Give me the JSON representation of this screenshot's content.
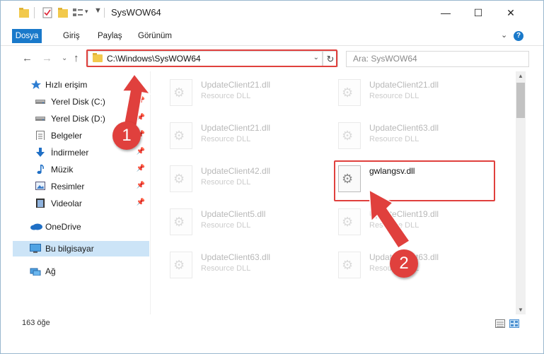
{
  "window": {
    "title": "SysWOW64",
    "minimize": "—",
    "maximize": "☐",
    "close": "✕"
  },
  "ribbon": {
    "tabs": [
      "Dosya",
      "Giriş",
      "Paylaş",
      "Görünüm"
    ],
    "expand": "⌄",
    "help": "?"
  },
  "address": {
    "path": "C:\\Windows\\SysWOW64",
    "dropdown": "⌄",
    "refresh": "↻",
    "search_placeholder": "Ara: SysWOW64"
  },
  "nav": {
    "back": "←",
    "forward": "→",
    "recent": "⌄",
    "up": "↑"
  },
  "sidebar": {
    "items": [
      {
        "label": "Hızlı erişim",
        "icon": "star-icon",
        "pinned": false
      },
      {
        "label": "Yerel Disk (C:)",
        "icon": "drive-icon",
        "pinned": true
      },
      {
        "label": "Yerel Disk (D:)",
        "icon": "drive-icon",
        "pinned": true
      },
      {
        "label": "Belgeler",
        "icon": "documents-icon",
        "pinned": true
      },
      {
        "label": "İndirmeler",
        "icon": "download-icon",
        "pinned": true
      },
      {
        "label": "Müzik",
        "icon": "music-icon",
        "pinned": true
      },
      {
        "label": "Resimler",
        "icon": "pictures-icon",
        "pinned": true
      },
      {
        "label": "Videolar",
        "icon": "videos-icon",
        "pinned": true
      },
      {
        "label": "OneDrive",
        "icon": "cloud-icon",
        "pinned": false
      },
      {
        "label": "Bu bilgisayar",
        "icon": "computer-icon",
        "pinned": false
      },
      {
        "label": "Ağ",
        "icon": "network-icon",
        "pinned": false
      }
    ],
    "pin_glyph": "📌"
  },
  "files": [
    {
      "name": "UpdateClient21.dll",
      "type": "Resource DLL"
    },
    {
      "name": "UpdateClient21.dll",
      "type": "Resource DLL"
    },
    {
      "name": "UpdateClient21.dll",
      "type": "Resource DLL"
    },
    {
      "name": "UpdateClient63.dll",
      "type": "Resource DLL"
    },
    {
      "name": "UpdateClient42.dll",
      "type": "Resource DLL"
    },
    {
      "name": "gwlangsv.dll",
      "type": ""
    },
    {
      "name": "UpdateClient5.dll",
      "type": "Resource DLL"
    },
    {
      "name": "UpdateClient19.dll",
      "type": "Resource DLL"
    },
    {
      "name": "UpdateClient63.dll",
      "type": "Resource DLL"
    },
    {
      "name": "UpdateClient63.dll",
      "type": "Resource DLL"
    }
  ],
  "status": {
    "count": "163 öğe"
  },
  "callouts": {
    "step1": "1",
    "step2": "2"
  },
  "colors": {
    "accent": "#1979ca",
    "highlight": "#e0403d",
    "selected": "#cce4f7"
  }
}
